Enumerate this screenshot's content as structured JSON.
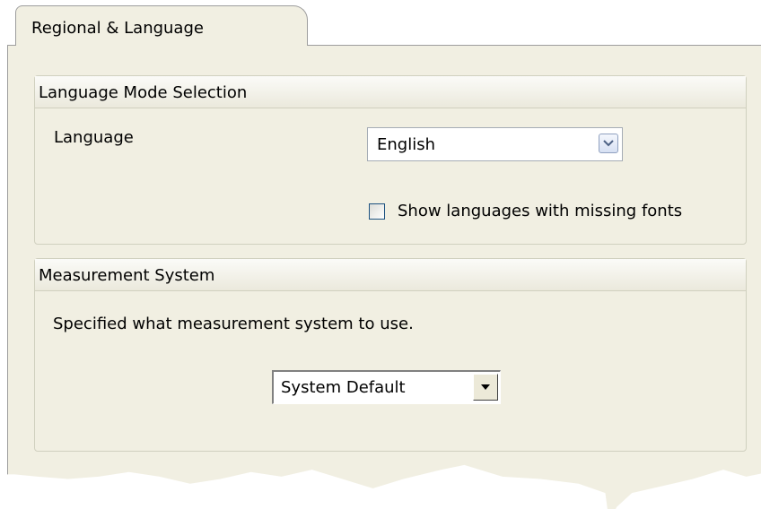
{
  "tab": {
    "label": "Regional & Language"
  },
  "language_group": {
    "title": "Language Mode Selection",
    "language_label": "Language",
    "language_value": "English",
    "missing_fonts_label": "Show languages with missing fonts",
    "missing_fonts_checked": false
  },
  "measurement_group": {
    "title": "Measurement System",
    "description": "Specified what measurement system to use.",
    "measurement_value": "System Default"
  },
  "icons": {
    "language_dropdown": "chevron-down-icon",
    "measurement_dropdown": "triangle-down-icon"
  }
}
